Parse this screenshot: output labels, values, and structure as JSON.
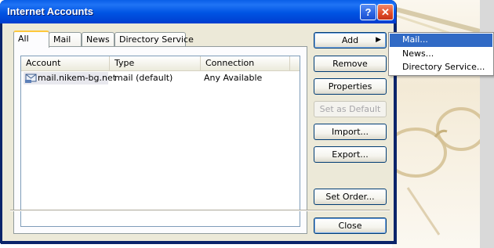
{
  "window": {
    "title": "Internet Accounts"
  },
  "titlebar_buttons": {
    "help": "?",
    "close": "✕"
  },
  "tabs": [
    {
      "label": "All",
      "active": true
    },
    {
      "label": "Mail",
      "active": false
    },
    {
      "label": "News",
      "active": false
    },
    {
      "label": "Directory Service",
      "active": false
    }
  ],
  "list": {
    "columns": [
      "Account",
      "Type",
      "Connection"
    ],
    "rows": [
      {
        "account": "mail.nikem-bg.net",
        "type": "mail (default)",
        "connection": "Any Available",
        "icon": "mail-account-icon"
      }
    ]
  },
  "buttons": {
    "add": "Add",
    "remove": "Remove",
    "properties": "Properties",
    "set_default": "Set as Default",
    "import": "Import...",
    "export": "Export...",
    "set_order": "Set Order...",
    "close": "Close"
  },
  "add_menu": {
    "items": [
      "Mail...",
      "News...",
      "Directory Service..."
    ],
    "highlighted_index": 0
  },
  "colors": {
    "titlebar": "#0054e3",
    "menu_highlight": "#316ac5",
    "dialog_face": "#ece9d8"
  }
}
